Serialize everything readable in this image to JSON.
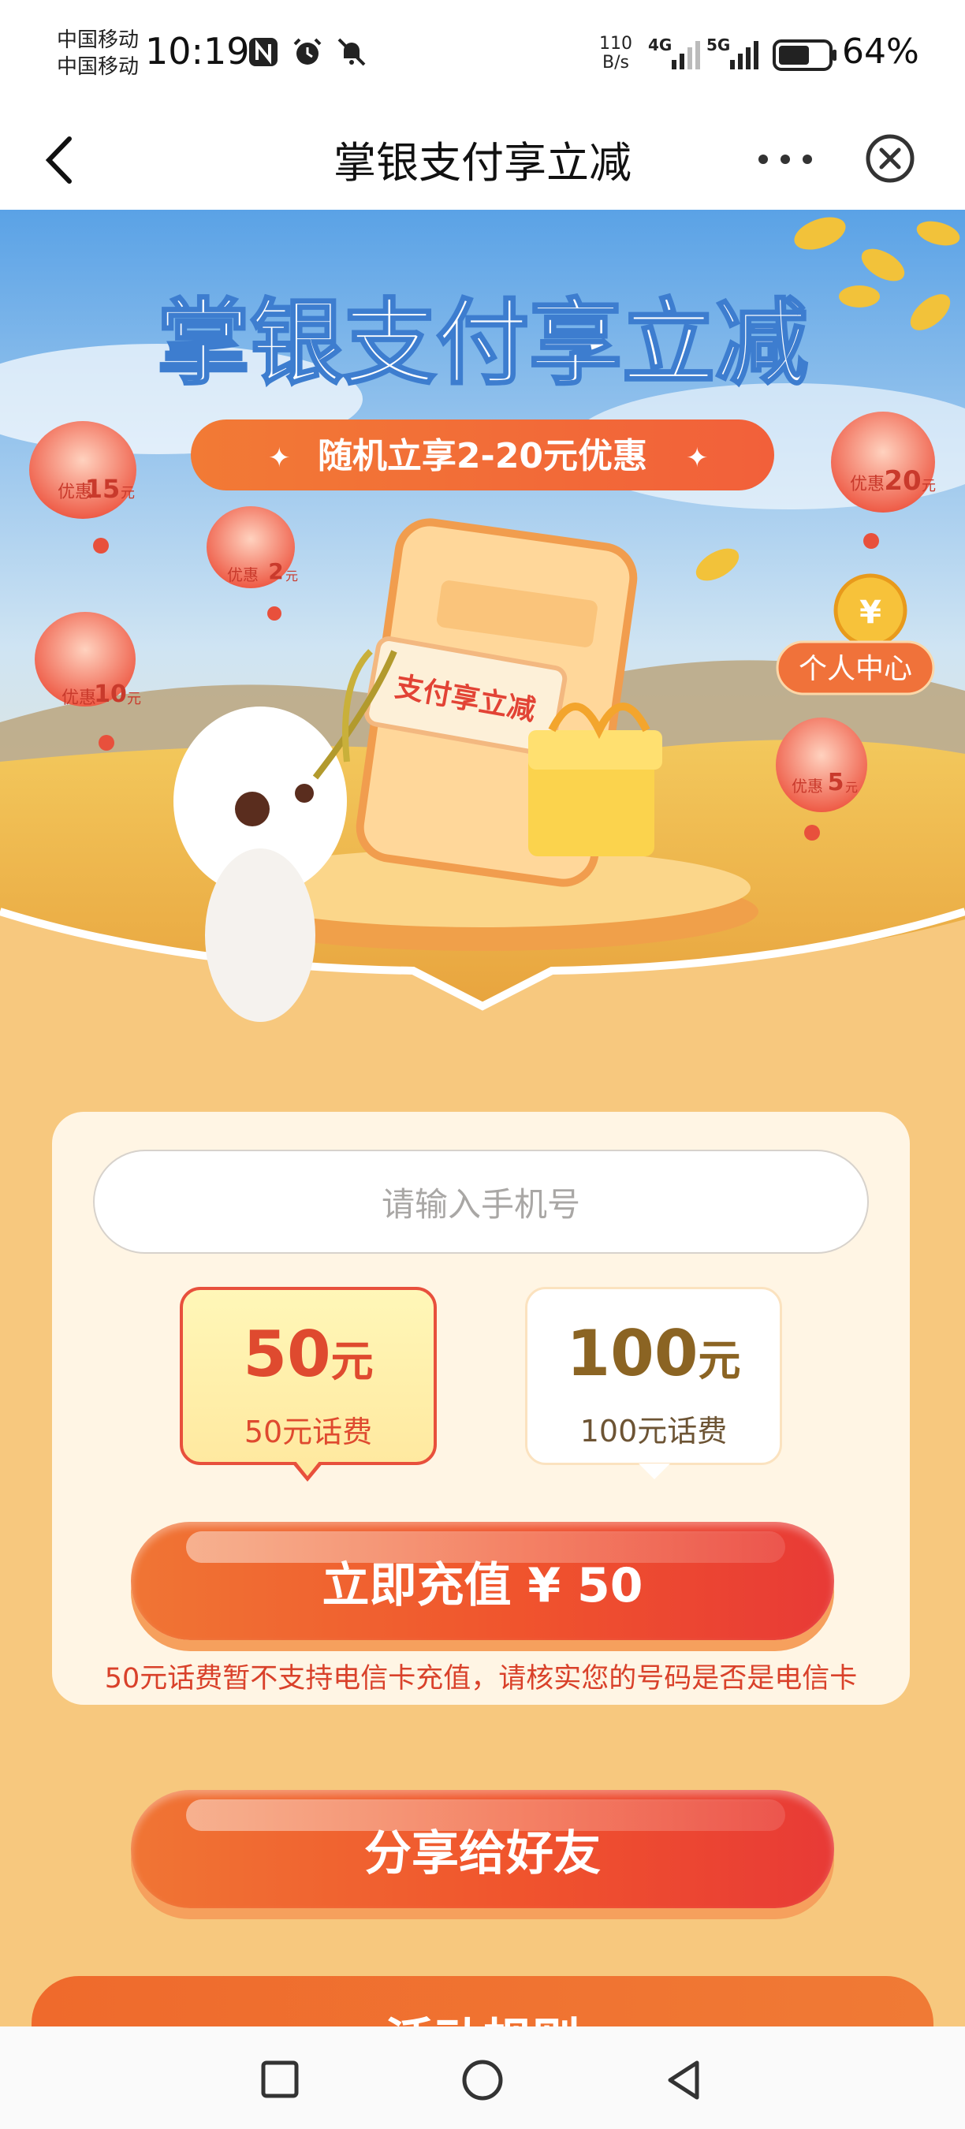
{
  "status_bar": {
    "carrier_1": "中国移动",
    "carrier_2": "中国移动",
    "time": "10:19",
    "net_speed_value": "110",
    "net_speed_unit": "B/s",
    "network_1": "4G",
    "network_2": "5G",
    "battery": "64%",
    "battery_level": 0.64,
    "icons": [
      "nfc-icon",
      "alarm-icon",
      "mute-bell-icon",
      "signal-icon",
      "battery-icon"
    ]
  },
  "nav": {
    "title": "掌银支付享立减",
    "back_icon": "chevron-left-icon",
    "more_icon": "more-dots-icon",
    "close_icon": "close-circle-icon"
  },
  "hero": {
    "title": "掌银支付享立减",
    "subtitle": "随机立享2-20元优惠",
    "center_text": "支付享立减",
    "personal_center": "个人中心",
    "lanterns": [
      {
        "label": "优惠",
        "amount": "15",
        "unit": "元"
      },
      {
        "label": "优惠",
        "amount": "2",
        "unit": "元"
      },
      {
        "label": "优惠",
        "amount": "10",
        "unit": "元"
      },
      {
        "label": "优惠",
        "amount": "20",
        "unit": "元"
      },
      {
        "label": "优惠",
        "amount": "5",
        "unit": "元"
      }
    ]
  },
  "form": {
    "phone_placeholder": "请输入手机号",
    "options": [
      {
        "amount": "50",
        "unit": "元",
        "desc": "50元话费",
        "selected": true
      },
      {
        "amount": "100",
        "unit": "元",
        "desc": "100元话费",
        "selected": false
      }
    ],
    "recharge_button": "立即充值 ¥ 50",
    "note": "50元话费暂不支持电信卡充值，请核实您的号码是否是电信卡"
  },
  "share_button": "分享给好友",
  "rules_label": "活动规则",
  "colors": {
    "page_bg": "#f7c87e",
    "accent_red": "#e8503c",
    "button_orange": "#f0542d",
    "gold_text": "#8b6423"
  }
}
